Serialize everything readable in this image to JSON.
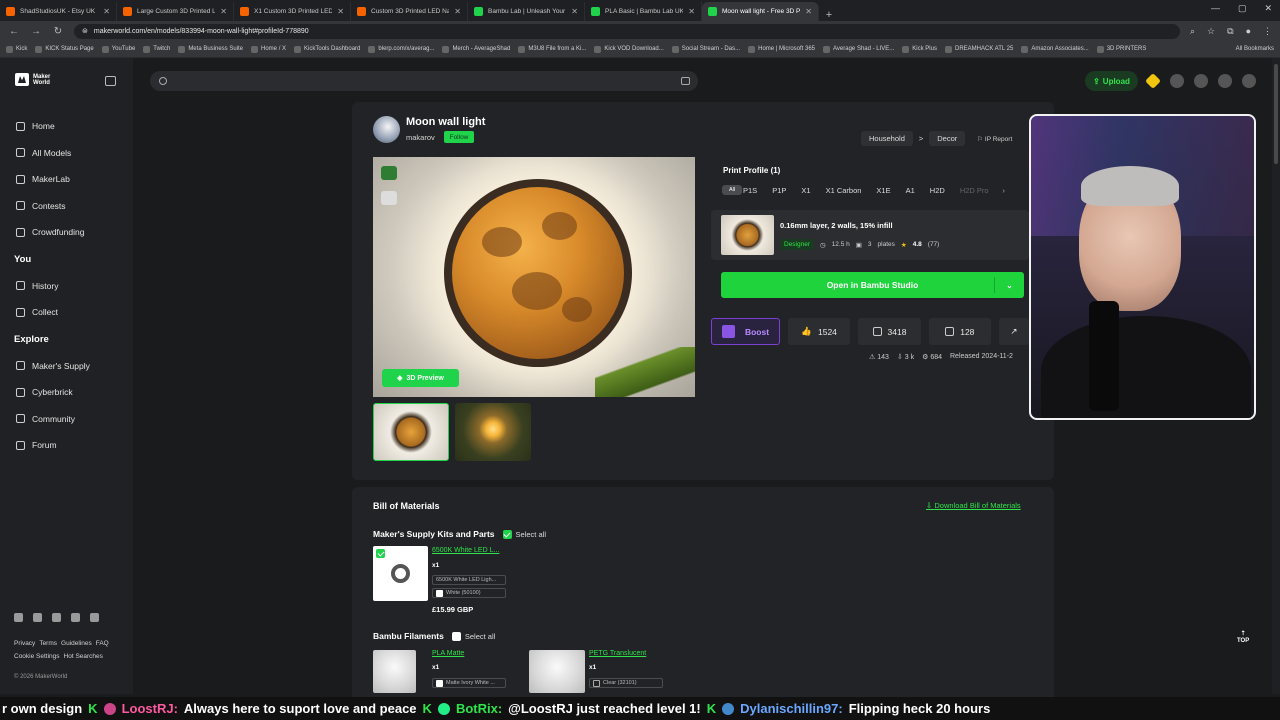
{
  "browser": {
    "tabs": [
      {
        "label": "ShadStudiosUK - Etsy UK",
        "color": "#f56400"
      },
      {
        "label": "Large Custom 3D Printed L",
        "color": "#f56400"
      },
      {
        "label": "X1 Custom 3D Printed LED Sig",
        "color": "#f56400"
      },
      {
        "label": "Custom 3D Printed LED Name",
        "color": "#f56400"
      },
      {
        "label": "Bambu Lab | Unleash Your Crea",
        "color": "#1fd34a"
      },
      {
        "label": "PLA Basic | Bambu Lab UK Stor",
        "color": "#1fd34a"
      },
      {
        "label": "Moon wall light - Free 3D Print",
        "color": "#1fd34a"
      }
    ],
    "url": "makerworld.com/en/models/833994-moon-wall-light#profileId-778890",
    "bookmarks": [
      "Kick",
      "KICK Status Page",
      "YouTube",
      "Twitch",
      "Meta Business Suite",
      "Home / X",
      "KickTools Dashboard",
      "blerp.com/x/averag...",
      "Merch - AverageShad",
      "M3U8 File from a Ki...",
      "Kick VOD Download...",
      "Social Stream - Das...",
      "Home | Microsoft 365",
      "Average Shad - LIVE...",
      "Kick Plus",
      "DREAMHACK ATL 25",
      "Amazon Associates...",
      "3D PRINTERS"
    ],
    "all_bookmarks": "All Bookmarks"
  },
  "sidebar": {
    "logo_line1": "Maker",
    "logo_line2": "World",
    "items": [
      {
        "label": "Home"
      },
      {
        "label": "All Models"
      },
      {
        "label": "MakerLab"
      },
      {
        "label": "Contests"
      },
      {
        "label": "Crowdfunding"
      }
    ],
    "you_heading": "You",
    "you_items": [
      {
        "label": "History"
      },
      {
        "label": "Collect"
      }
    ],
    "explore_heading": "Explore",
    "explore_items": [
      {
        "label": "Maker's Supply"
      },
      {
        "label": "Cyberbrick"
      },
      {
        "label": "Community"
      },
      {
        "label": "Forum"
      }
    ],
    "footer_links": [
      "Privacy",
      "Terms",
      "Guidelines",
      "FAQ",
      "Cookie Settings",
      "Hot Searches"
    ],
    "copyright": "© 2026 MakerWorld"
  },
  "header": {
    "upload_label": "Upload"
  },
  "model": {
    "title": "Moon wall light",
    "author": "makarov",
    "follow_label": "Follow",
    "crumb1": "Household",
    "crumb_sep": ">",
    "crumb2": "Decor",
    "ip_report": "IP Report",
    "preview_label": "3D Preview"
  },
  "print_profile": {
    "title": "Print Profile (1)",
    "tabs": [
      "All",
      "P1S",
      "P1P",
      "X1",
      "X1 Carbon",
      "X1E",
      "A1",
      "H2D",
      "H2D Pro"
    ],
    "profile_name": "0.16mm layer, 2 walls, 15% infill",
    "designer_badge": "Designer",
    "time": "12.5 h",
    "plates": "3",
    "plates_label": "plates",
    "rating": "4.8",
    "rating_count": "(77)",
    "open_label": "Open in Bambu Studio"
  },
  "stats": {
    "boost_label": "Boost",
    "likes": "1524",
    "collects": "3418",
    "comments": "128",
    "sub_prints": "143",
    "sub_downloads": "3 k",
    "sub_makes": "684",
    "released": "Released 2024-11-2"
  },
  "bom": {
    "title": "Bill of Materials",
    "download_label": "Download Bill of Materials",
    "supply_title": "Maker's Supply Kits and Parts",
    "select_all": "Select all",
    "supply_item": {
      "name": "6500K White LED L...",
      "qty": "x1",
      "variant": "6500K White LED Ligh...",
      "color": "White (50100)",
      "price": "£15.99 GBP"
    },
    "filaments_title": "Bambu Filaments",
    "filaments": [
      {
        "name": "PLA Matte",
        "qty": "x1",
        "color": "Matte Ivory White ..."
      },
      {
        "name": "PETG Translucent",
        "qty": "x1",
        "color": "Clear (32101)"
      }
    ]
  },
  "top_button": "TOP",
  "ticker": {
    "prefix": "r own design",
    "user1": "LoostRJ:",
    "msg1": "Always here to suport love and peace",
    "user2": "BotRix:",
    "msg2": "@LoostRJ just reached level 1!",
    "user3": "Dylanischillin97:",
    "msg3": "Flipping heck 20 hours"
  }
}
